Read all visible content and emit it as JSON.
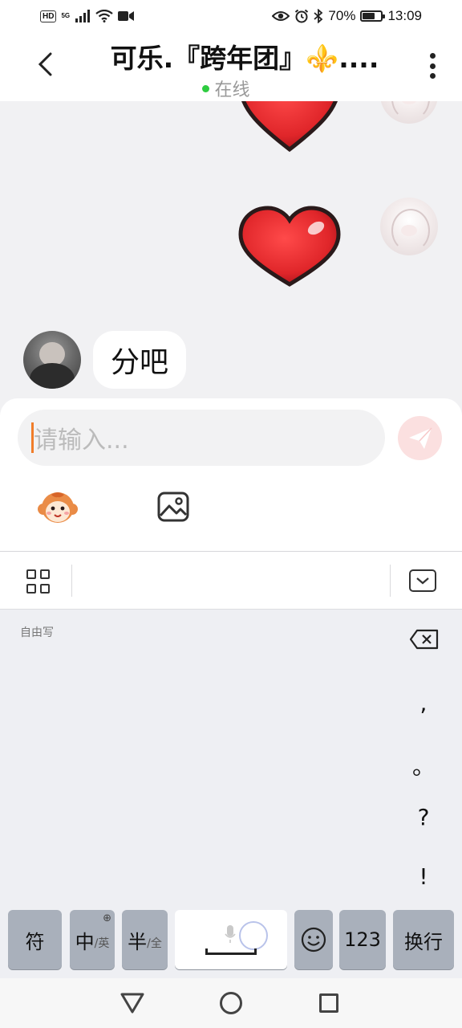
{
  "status_bar": {
    "hd_label": "HD",
    "network_label": "5G",
    "battery_text": "70%",
    "battery_level": 0.7,
    "time": "13:09",
    "icons": [
      "signal-icon",
      "wifi-icon",
      "video-icon",
      "eye-icon",
      "alarm-icon",
      "bluetooth-icon",
      "battery-icon"
    ]
  },
  "header": {
    "title": "可乐.『跨年团』⚜️....",
    "status_text": "在线",
    "status_color": "#2ecc40"
  },
  "messages": [
    {
      "from": "self",
      "type": "sticker",
      "sticker": "red-heart"
    },
    {
      "from": "self",
      "type": "sticker",
      "sticker": "red-heart"
    },
    {
      "from": "peer",
      "type": "text",
      "text": "分吧"
    }
  ],
  "composer": {
    "placeholder": "请输入...",
    "caret_color": "#f07d2a",
    "send_color": "#fbe0e0"
  },
  "keyboard": {
    "mode_label": "自由写",
    "punctuation": [
      ",",
      "。",
      "?",
      "!"
    ],
    "keys": {
      "symbols": "符",
      "chinese": "中",
      "chinese_alt": "/英",
      "half": "半",
      "half_alt": "/全",
      "numbers": "123",
      "newline": "换行"
    }
  },
  "colors": {
    "accent_orange": "#f07d2a",
    "heart_red": "#e0262a",
    "key_gray": "#a9b0bb"
  }
}
